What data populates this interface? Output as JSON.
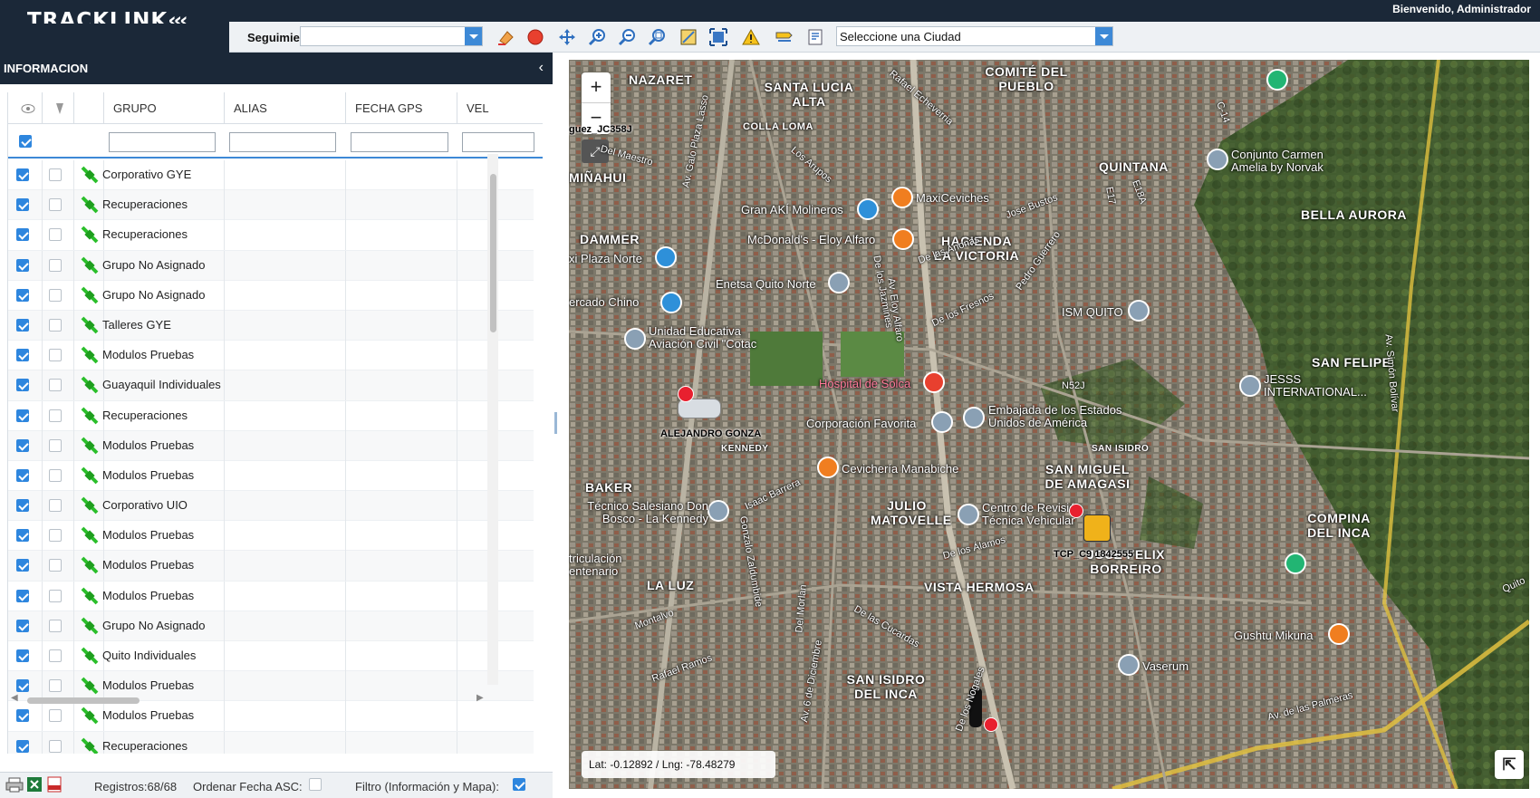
{
  "header": {
    "logo": "TRACKLINK",
    "welcome": "Bienvenido, Administrador"
  },
  "toolbar": {
    "tracking_label": "Seguimiento:",
    "tracking_value": "",
    "city_select": "Seleccione una Ciudad",
    "tools": [
      "eraser-icon",
      "record-icon",
      "pan-icon",
      "zoom-in-icon",
      "zoom-out-icon",
      "zoom-extent-icon",
      "map-layer-icon",
      "fullscreen-select-icon",
      "warning-icon",
      "route-icon",
      "report-icon"
    ]
  },
  "panel": {
    "title": "INFORMACION",
    "collapse_icon": "chevron-left-icon"
  },
  "grid": {
    "columns": [
      "GRUPO",
      "ALIAS",
      "FECHA GPS",
      "VEL"
    ],
    "filter_all_checked": true,
    "rows": [
      {
        "group": "Corporativo GYE",
        "checked": true
      },
      {
        "group": "Recuperaciones",
        "checked": true
      },
      {
        "group": "Recuperaciones",
        "checked": true
      },
      {
        "group": "Grupo No Asignado",
        "checked": true
      },
      {
        "group": "Grupo No Asignado",
        "checked": true
      },
      {
        "group": "Talleres GYE",
        "checked": true
      },
      {
        "group": "Modulos Pruebas",
        "checked": true
      },
      {
        "group": "Guayaquil Individuales",
        "checked": true
      },
      {
        "group": "Recuperaciones",
        "checked": true
      },
      {
        "group": "Modulos Pruebas",
        "checked": true
      },
      {
        "group": "Modulos Pruebas",
        "checked": true
      },
      {
        "group": "Corporativo UIO",
        "checked": true
      },
      {
        "group": "Modulos Pruebas",
        "checked": true
      },
      {
        "group": "Modulos Pruebas",
        "checked": true
      },
      {
        "group": "Modulos Pruebas",
        "checked": true
      },
      {
        "group": "Grupo No Asignado",
        "checked": true
      },
      {
        "group": "Quito Individuales",
        "checked": true
      },
      {
        "group": "Modulos Pruebas",
        "checked": true
      },
      {
        "group": "Modulos Pruebas",
        "checked": true
      },
      {
        "group": "Recuperaciones",
        "checked": true
      }
    ]
  },
  "footer": {
    "records": "Registros:68/68",
    "order_label": "Ordenar Fecha ASC:",
    "order_checked": false,
    "filter_label": "Filtro (Información y Mapa):",
    "filter_checked": true
  },
  "map": {
    "zoom_in": "+",
    "zoom_out": "−",
    "latlng": "Lat: -0.12892 / Lng: -78.48279",
    "areas": [
      "NAZARET",
      "SANTA LUCIA ALTA",
      "COMITÉ DEL PUEBLO",
      "QUINTANA",
      "BELLA AURORA",
      "MIÑAHUI",
      "DAMMER",
      "HACIENDA LA VICTORIA",
      "SAN FELIPE",
      "SAN MIGUEL DE AMAGASI",
      "JULIO MATOVELLE",
      "COMPINA DEL INCA",
      "LA LUZ",
      "VISTA HERMOSA",
      "JOSE FELIX BORREIRO",
      "SAN ISIDRO DEL INCA",
      "BAKER",
      "KENNEDY",
      "SAN ISIDRO",
      "COLLA LOMA"
    ],
    "pois": [
      "MaxiCeviches",
      "Gran AKÍ Molineros",
      "McDonald's - Eloy Alfaro",
      "Enetsa Quito Norte",
      "ISM QUITO",
      "Conjunto Carmen Amelia by Norvak",
      "Unidad Educativa Aviación Civil \"Cotac",
      "Hospital de Solca",
      "Embajada de los Estados Unidos de América",
      "Corporación Favorita",
      "JESSS INTERNATIONAL...",
      "Cevichería Manabiche",
      "Centro de Revisión Técnica Vehicular",
      "Técnico Salesiano Don Bosco - La Kennedy",
      "Gushtu Mikuna",
      "Vaserum",
      "ercado Chino",
      "xi Plaza Norte",
      "triculación entenario"
    ],
    "vehicles": [
      "ALEJANDRO GONZA",
      "TCP_C9 1842555",
      "guez_JC358J"
    ],
    "roads": [
      "Av. Galo Plaza Lasso",
      "Av. Eloy Alfaro",
      "Av. Simón Bolívar",
      "Av. de las Palmeras",
      "Av. 6 de Diciembre",
      "De los Álamos",
      "De las Anonas",
      "Isaac Barrera",
      "Gonzalo Zaldumbide",
      "Rafael Ramos",
      "Montalvo",
      "N52J",
      "Quito",
      "Jose Bustos",
      "Del Maestro",
      "De los Nogales",
      "De los Fresnos",
      "De las Cucardas",
      "De los Jazmines",
      "Pedro Guerrero",
      "Rafael Echeverria",
      "Los Arupos",
      "Del Morlan",
      "C-14",
      "E18A",
      "E17"
    ],
    "expand_icon": "arrow-up-left-icon"
  }
}
